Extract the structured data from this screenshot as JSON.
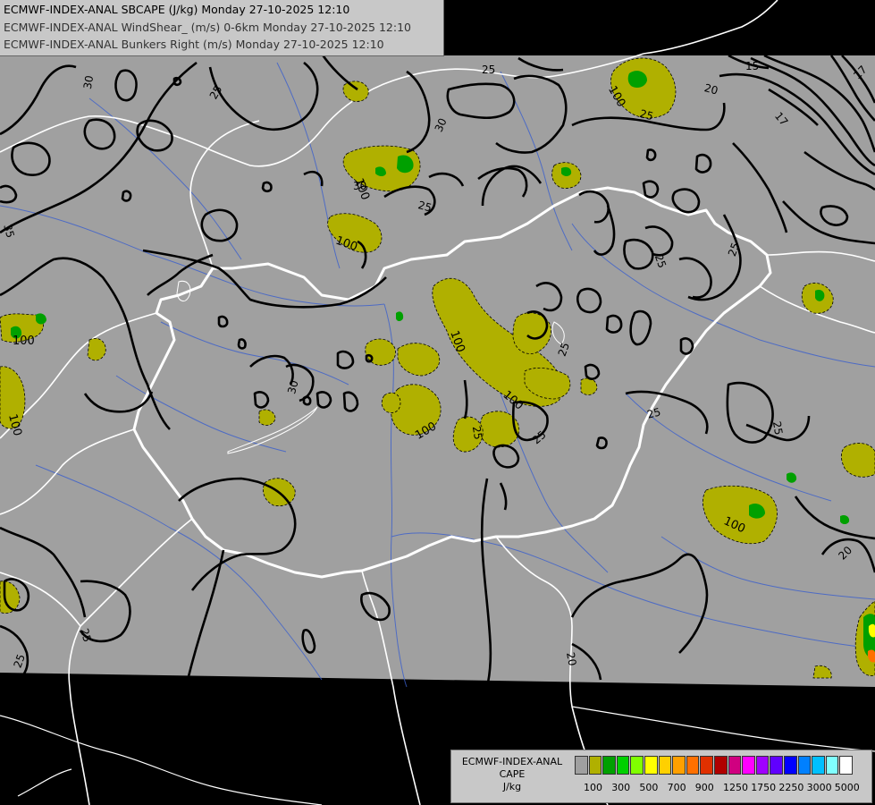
{
  "header": {
    "line1": "ECMWF-INDEX-ANAL SBCAPE (J/kg) Monday 27-10-2025 12:10",
    "line2": "ECMWF-INDEX-ANAL WindShear_ (m/s) 0-6km Monday 27-10-2025 12:10",
    "line3": "ECMWF-INDEX-ANAL Bunkers Right (m/s) Monday 27-10-2025 12:10"
  },
  "legend": {
    "title_line1": "ECMWF-INDEX-ANAL",
    "title_line2": "CAPE",
    "title_line3": "J/kg",
    "colors": [
      "#a0a0a0",
      "#b0b000",
      "#00a000",
      "#00d000",
      "#80ff00",
      "#ffff00",
      "#ffd000",
      "#ffa000",
      "#ff7000",
      "#e03000",
      "#b00000",
      "#d00080",
      "#ff00ff",
      "#a000ff",
      "#6000ff",
      "#0000ff",
      "#0080ff",
      "#00c0ff",
      "#80ffff",
      "#ffffff"
    ],
    "tick_labels": [
      "100",
      "300",
      "500",
      "700",
      "900",
      "1250",
      "1750",
      "2250",
      "3000",
      "5000"
    ]
  },
  "map_labels": {
    "cape": [
      "100",
      "100",
      "100",
      "100",
      "100",
      "100",
      "100",
      "100"
    ],
    "shear": [
      "30",
      "25",
      "25",
      "30",
      "30",
      "25",
      "25",
      "25",
      "25",
      "25",
      "17",
      "15",
      "20",
      "17",
      "35",
      "30",
      "25",
      "25",
      "25",
      "20",
      "25",
      "20",
      "25",
      "25"
    ]
  },
  "colors": {
    "background": "#000000",
    "domain": "#a0a0a0",
    "cape_100": "#b0b000",
    "cape_300": "#00a000",
    "borders": "#ffffff",
    "rivers": "#3a5fcd",
    "contours": "#000000"
  }
}
